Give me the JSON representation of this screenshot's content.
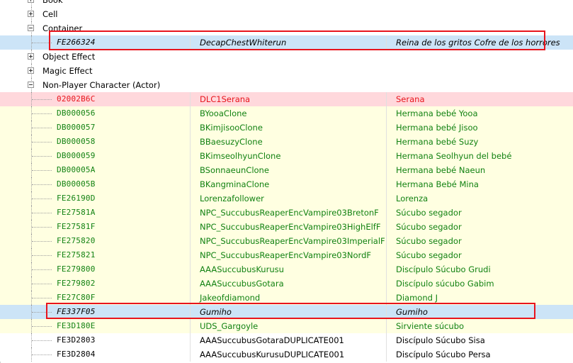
{
  "groups": {
    "book": "Book",
    "cell": "Cell",
    "container": "Container",
    "object_effect": "Object Effect",
    "magic_effect": "Magic Effect",
    "npc": "Non-Player Character (Actor)"
  },
  "container_rows": [
    {
      "formid": "FE266324",
      "editorid": "DecapChestWhiterun",
      "name": "Reina de los gritos Cofre de los horrores",
      "style": "selected"
    }
  ],
  "npc_rows": [
    {
      "formid": "02002B6C",
      "editorid": "DLC1Serana",
      "name": "Serana",
      "style": "red"
    },
    {
      "formid": "DB000056",
      "editorid": "BYooaClone",
      "name": "Hermana bebé Yooa",
      "style": "yellow"
    },
    {
      "formid": "DB000057",
      "editorid": "BKimjisooClone",
      "name": "Hermana bebé Jisoo",
      "style": "yellow"
    },
    {
      "formid": "DB000058",
      "editorid": "BBaesuzyClone",
      "name": "Hermana bebé Suzy",
      "style": "yellow"
    },
    {
      "formid": "DB000059",
      "editorid": "BKimseolhyunClone",
      "name": "Hermana Seolhyun del bebé",
      "style": "yellow"
    },
    {
      "formid": "DB00005A",
      "editorid": "BSonnaeunClone",
      "name": "Hermana bebé Naeun",
      "style": "yellow"
    },
    {
      "formid": "DB00005B",
      "editorid": "BKangminaClone",
      "name": "Hermana Bebé Mina",
      "style": "yellow"
    },
    {
      "formid": "FE26190D",
      "editorid": "Lorenzafollower",
      "name": "Lorenza",
      "style": "yellow"
    },
    {
      "formid": "FE27581A",
      "editorid": "NPC_SuccubusReaperEncVampire03BretonF",
      "name": "Súcubo segador",
      "style": "yellow"
    },
    {
      "formid": "FE27581F",
      "editorid": "NPC_SuccubusReaperEncVampire03HighElfF",
      "name": "Súcubo segador",
      "style": "yellow"
    },
    {
      "formid": "FE275820",
      "editorid": "NPC_SuccubusReaperEncVampire03ImperialF",
      "name": "Súcubo segador",
      "style": "yellow"
    },
    {
      "formid": "FE275821",
      "editorid": "NPC_SuccubusReaperEncVampire03NordF",
      "name": "Súcubo segador",
      "style": "yellow"
    },
    {
      "formid": "FE279800",
      "editorid": "AAASuccubusKurusu",
      "name": "Discípulo Súcubo Grudi",
      "style": "yellow"
    },
    {
      "formid": "FE279802",
      "editorid": "AAASuccubusGotara",
      "name": "Discípulo súcubo Gabim",
      "style": "yellow"
    },
    {
      "formid": "FE27C80F",
      "editorid": "Jakeofdiamond",
      "name": "Diamond J",
      "style": "yellow"
    },
    {
      "formid": "FE337F05",
      "editorid": "Gumiho",
      "name": "Gumiho",
      "style": "selected"
    },
    {
      "formid": "FE3D180E",
      "editorid": "UDS_Gargoyle",
      "name": "Sirviente súcubo",
      "style": "yellow"
    },
    {
      "formid": "FE3D2803",
      "editorid": "AAASuccubusGotaraDUPLICATE001",
      "name": "Discípulo Súcubo Sisa",
      "style": "white"
    },
    {
      "formid": "FE3D2804",
      "editorid": "AAASuccubusKurusuDUPLICATE001",
      "name": "Discípulo Súcubo Persa",
      "style": "white"
    }
  ],
  "colors": {
    "selection": "#cce4f7",
    "conflict_red_bg": "#ffd8dc",
    "conflict_red_text": "#e8141c",
    "override_yellow_bg": "#ffffe1",
    "override_green_text": "#128212",
    "highlight_box": "#e8141c"
  }
}
